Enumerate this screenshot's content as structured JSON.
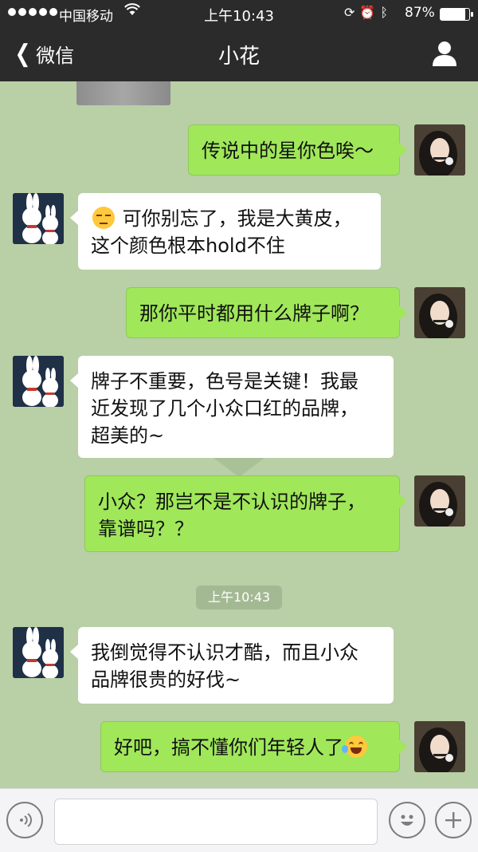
{
  "status_bar": {
    "carrier": "中国移动",
    "time": "上午10:43",
    "battery_percent": "87%",
    "battery_level": 0.87,
    "signal_dots": 5
  },
  "nav": {
    "back_label": "微信",
    "title": "小花"
  },
  "chat": {
    "time_separator": "上午10:43",
    "messages": [
      {
        "side": "out",
        "text": "传说中的星你色唉～"
      },
      {
        "side": "in",
        "emoji": "sulk-emoji",
        "text": "可你别忘了，我是大黄皮，",
        "text2": "这个颜色根本hold不住"
      },
      {
        "side": "out",
        "text": "那你平时都用什么牌子啊？"
      },
      {
        "side": "in",
        "text": "牌子不重要，色号是关键！我最",
        "text2": "近发现了几个小众口红的品牌，",
        "text3": "超美的~"
      },
      {
        "side": "out",
        "text": "小众？那岂不是不认识的牌子，",
        "text2": "靠谱吗？？"
      },
      {
        "side": "in",
        "text": "我倒觉得不认识才酷，而且小众",
        "text2": "品牌很贵的好伐~"
      },
      {
        "side": "out",
        "text": "好吧，搞不懂你们年轻人了",
        "emoji": "laugh-cry-emoji"
      }
    ]
  },
  "colors": {
    "nav_bg": "#2b2b2b",
    "chat_bg": "#b9cfa6",
    "bubble_out": "#a0e75a",
    "bubble_in": "#ffffff"
  },
  "icons": {
    "back": "chevron-left-icon",
    "profile": "person-icon",
    "voice": "voice-icon",
    "emoji": "smiley-icon",
    "more": "plus-icon"
  }
}
